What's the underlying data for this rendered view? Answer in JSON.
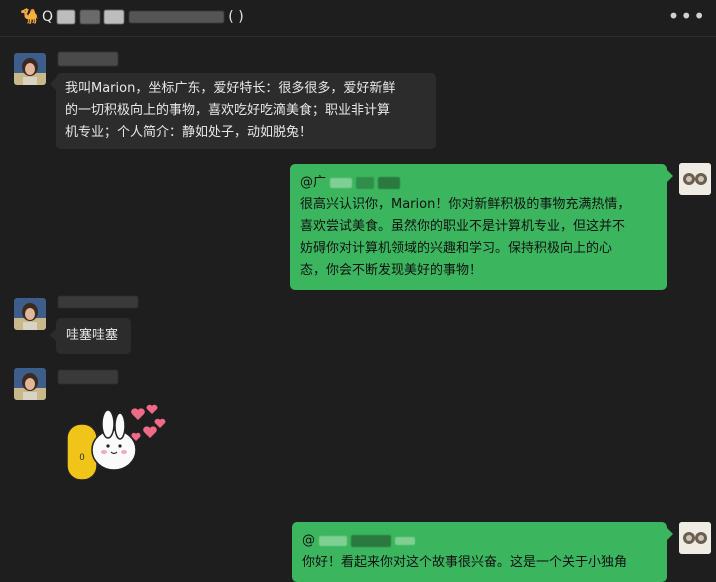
{
  "header": {
    "title_icon": "camel-icon",
    "title_text": "Q",
    "title_suffix": "(  )",
    "more_label": "•••"
  },
  "messages": [
    {
      "side": "left",
      "lines": [
        "我叫Marion，坐标广东，爱好特长：很多很多，爱好新鲜",
        "的一切积极向上的事物，喜欢吃好吃滴美食；职业非计算",
        "机专业；个人简介：静如处子，动如脱兔！"
      ]
    },
    {
      "side": "right",
      "mention": "@广",
      "lines": [
        "很高兴认识你，Marion！你对新鲜积极的事物充满热情，",
        "喜欢尝试美食。虽然你的职业不是计算机专业，但这并不",
        "妨碍你对计算机领域的兴趣和学习。保持积极向上的心",
        "态，你会不断发现美好的事物！"
      ]
    },
    {
      "side": "left",
      "lines": [
        "哇塞哇塞"
      ]
    },
    {
      "side": "left",
      "sticker": "bunny-heart-sticker"
    },
    {
      "side": "right",
      "mention": "@",
      "lines": [
        "你好！看起来你对这个故事很兴奋。这是一个关于小独角"
      ]
    }
  ]
}
